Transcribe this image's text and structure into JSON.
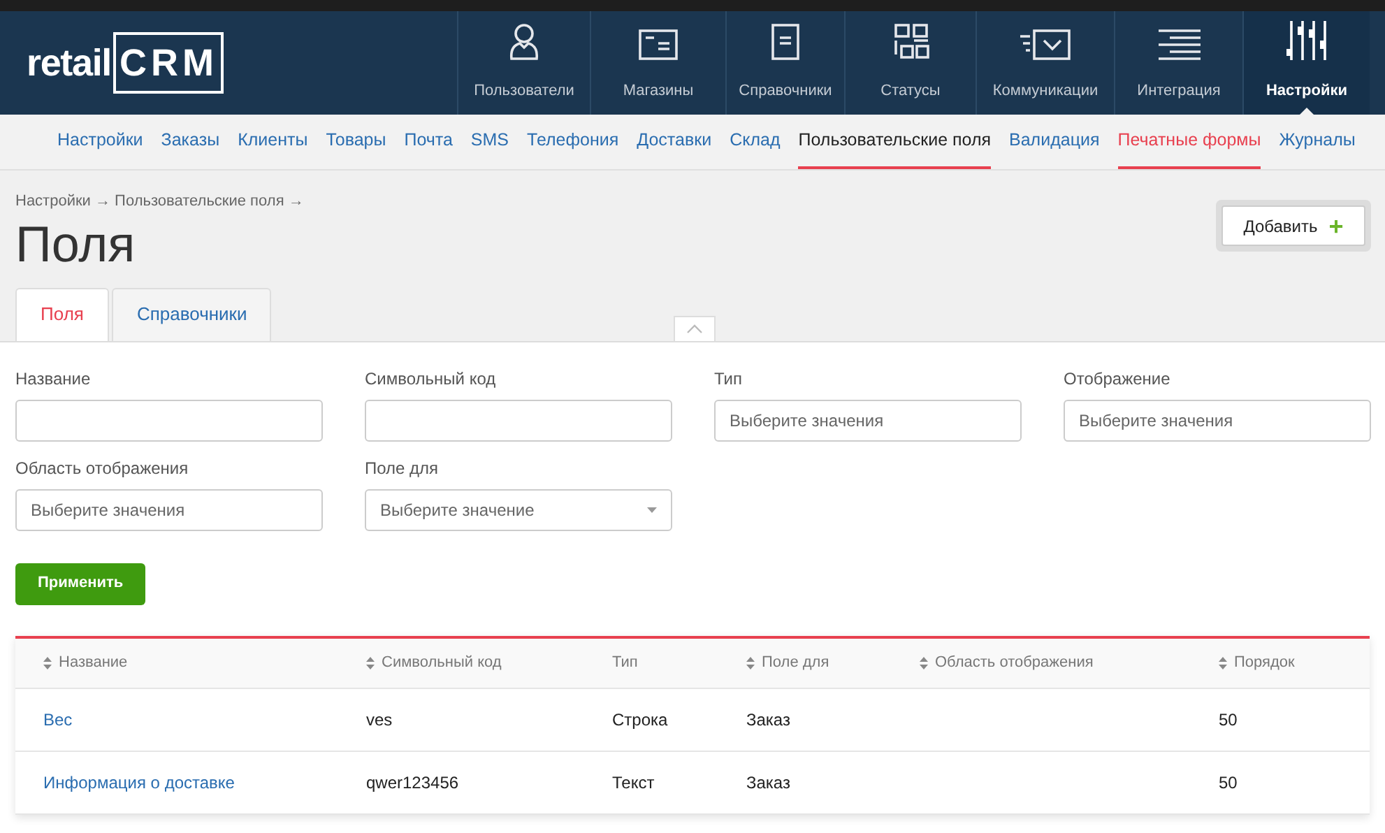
{
  "logo": {
    "text": "retail",
    "mark": "CRM"
  },
  "nav": [
    {
      "label": "Пользователи",
      "selected": false
    },
    {
      "label": "Магазины",
      "selected": false
    },
    {
      "label": "Справочники",
      "selected": false
    },
    {
      "label": "Статусы",
      "selected": false
    },
    {
      "label": "Коммуникации",
      "selected": false
    },
    {
      "label": "Интеграция",
      "selected": false
    },
    {
      "label": "Настройки",
      "selected": true
    }
  ],
  "subnav": [
    {
      "label": "Настройки",
      "selected": false,
      "highlighted": false
    },
    {
      "label": "Заказы",
      "selected": false,
      "highlighted": false
    },
    {
      "label": "Клиенты",
      "selected": false,
      "highlighted": false
    },
    {
      "label": "Товары",
      "selected": false,
      "highlighted": false
    },
    {
      "label": "Почта",
      "selected": false,
      "highlighted": false
    },
    {
      "label": "SMS",
      "selected": false,
      "highlighted": false
    },
    {
      "label": "Телефония",
      "selected": false,
      "highlighted": false
    },
    {
      "label": "Доставки",
      "selected": false,
      "highlighted": false
    },
    {
      "label": "Склад",
      "selected": false,
      "highlighted": false
    },
    {
      "label": "Пользовательские поля",
      "selected": true,
      "highlighted": false
    },
    {
      "label": "Валидация",
      "selected": false,
      "highlighted": false
    },
    {
      "label": "Печатные формы",
      "selected": false,
      "highlighted": true
    },
    {
      "label": "Журналы",
      "selected": false,
      "highlighted": false
    }
  ],
  "breadcrumb": "Настройки → Пользовательские поля →",
  "title": "Поля",
  "add_button": {
    "label": "Добавить",
    "icon": "+"
  },
  "tabs": [
    {
      "label": "Поля",
      "selected": true
    },
    {
      "label": "Справочники",
      "selected": false
    }
  ],
  "filters": [
    {
      "label": "Название",
      "kind": "input"
    },
    {
      "label": "Символьный код",
      "kind": "input"
    },
    {
      "label": "Тип",
      "kind": "multi",
      "placeholder": "Выберите значения"
    },
    {
      "label": "Отображение",
      "kind": "multi",
      "placeholder": "Выберите значения"
    },
    {
      "label": "Область отображения",
      "kind": "multi",
      "placeholder": "Выберите значения"
    },
    {
      "label": "Поле для",
      "kind": "select",
      "placeholder": "Выберите значение"
    }
  ],
  "filters_expanded": true,
  "apply_button": "Применить",
  "table": {
    "columns": [
      {
        "label": "Название",
        "sortable": true
      },
      {
        "label": "Символьный код",
        "sortable": true
      },
      {
        "label": "Тип",
        "sortable": false
      },
      {
        "label": "Поле для",
        "sortable": true
      },
      {
        "label": "Область отображения",
        "sortable": true
      },
      {
        "label": "Порядок",
        "sortable": true
      }
    ],
    "rows": [
      [
        "Вес",
        "ves",
        "Строка",
        "Заказ",
        "",
        "50"
      ],
      [
        "Информация о доставке",
        "qwer123456",
        "Текст",
        "Заказ",
        "",
        "50"
      ]
    ]
  }
}
